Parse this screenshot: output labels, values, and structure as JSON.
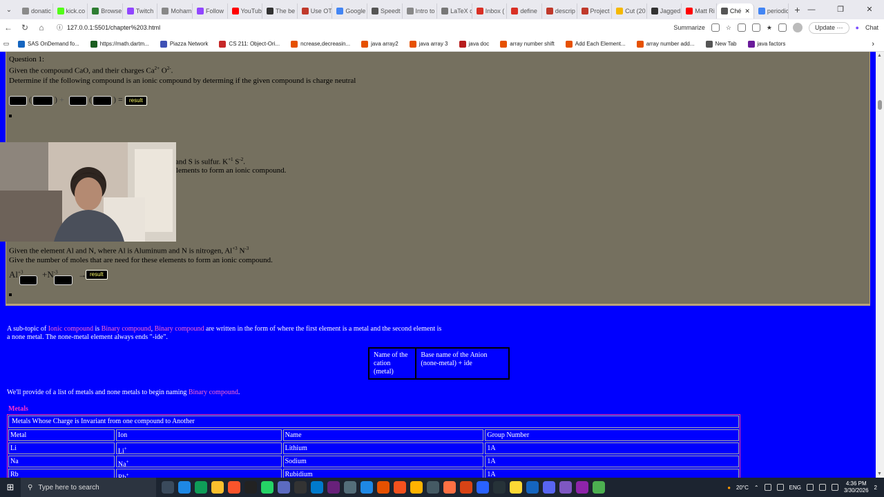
{
  "browser": {
    "tabs": [
      {
        "label": "donatic",
        "color": "#8a8a8a"
      },
      {
        "label": "kick.co",
        "color": "#53fc18"
      },
      {
        "label": "Browse",
        "color": "#2e7d32"
      },
      {
        "label": "Twitch",
        "color": "#9146ff"
      },
      {
        "label": "Moham",
        "color": "#888888"
      },
      {
        "label": "Follow",
        "color": "#9146ff"
      },
      {
        "label": "YouTub",
        "color": "#ff0000"
      },
      {
        "label": "The be",
        "color": "#333333"
      },
      {
        "label": "Use OT",
        "color": "#c0392b"
      },
      {
        "label": "Google",
        "color": "#4285f4"
      },
      {
        "label": "Speedt",
        "color": "#555555"
      },
      {
        "label": "Intro to",
        "color": "#888888"
      },
      {
        "label": "LaTeX c",
        "color": "#777777"
      },
      {
        "label": "Inbox (",
        "color": "#d93025"
      },
      {
        "label": "define",
        "color": "#d93025"
      },
      {
        "label": "descrip",
        "color": "#c0392b"
      },
      {
        "label": "Project",
        "color": "#c0392b"
      },
      {
        "label": "Cut (20",
        "color": "#f5b800"
      },
      {
        "label": "Jagged",
        "color": "#333333"
      },
      {
        "label": "Matt Ri",
        "color": "#ff0000"
      },
      {
        "label": "Ché",
        "color": "#555555",
        "active": true
      },
      {
        "label": "periodic",
        "color": "#4285f4"
      }
    ],
    "url": "127.0.0.1:5501/chapter%203.html",
    "summarize": "Summarize",
    "update": "Update",
    "chat": "Chat",
    "bookmarks": [
      {
        "label": "SAS OnDemand fo...",
        "color": "#1565c0"
      },
      {
        "label": "https://math.dartm...",
        "color": "#1b5e20"
      },
      {
        "label": "Piazza Network",
        "color": "#3f51b5"
      },
      {
        "label": "CS 211: Object-Ori...",
        "color": "#c62828"
      },
      {
        "label": "ncrease,decreasin...",
        "color": "#e65100"
      },
      {
        "label": "java array2",
        "color": "#e65100"
      },
      {
        "label": "java array 3",
        "color": "#e65100"
      },
      {
        "label": "java doc",
        "color": "#b71c1c"
      },
      {
        "label": "array number shift",
        "color": "#e65100"
      },
      {
        "label": "Add Each Element...",
        "color": "#e65100"
      },
      {
        "label": "array number add...",
        "color": "#e65100"
      },
      {
        "label": "New Tab",
        "color": "#555555"
      },
      {
        "label": "java factors",
        "color": "#6a1b9a"
      }
    ]
  },
  "page": {
    "q1": {
      "title": "Question 1:",
      "given_prefix": "Given the compound CaO, and their charges Ca",
      "ca_charge": "2+",
      "o_label": " O",
      "o_charge": "2-",
      "given_suffix": ".",
      "instruction": "Determine if the following compound is an ionic compound by determing if the given compound is charge neutral",
      "plus": "+",
      "equals": "=",
      "result_label": "result"
    },
    "q2": {
      "partial_line1_prefix": "and S is sulfur. K",
      "k_charge": "+1",
      "s_label": " S",
      "s_charge": "-2",
      "partial_line1_suffix": ".",
      "partial_line2": "elements to form an ionic compound."
    },
    "q3": {
      "given_prefix": "Given the element Al and N, where Al is Aluminum and N is nitrogen, Al",
      "al_charge": "+3",
      "n_label": " N",
      "n_charge": "-3",
      "instruction": "Give the number of moles that are need for these elements to form an ionic compound.",
      "al_symbol": "Al",
      "al_sup": "+3",
      "n_symbol": "+N",
      "n_sup": "-3",
      "arrow": "→",
      "result_label": "result"
    },
    "intro": {
      "p1_a": "A sub-topic of ",
      "p1_link1": "Ionic compound",
      "p1_b": " is ",
      "p1_link2": "Binary compound",
      "p1_c": ", ",
      "p1_link3": "Binary compound",
      "p1_d": " are written in the form of where the first element is a metal and the second element is",
      "p1_line2": "a none metal. The none-metal element always ends \"-ide\".",
      "p2_a": "We'll provide of a list of metals and none metals to begin naming ",
      "p2_link": "Binary compound",
      "p2_b": "."
    },
    "name_table": {
      "col1": "Name of the cation (metal)",
      "col2": "Base name of the Anion (none-metal) + ide"
    },
    "metals_link": "Metals",
    "metal_table": {
      "caption": "Metals Whose Charge is Invariant from one compound to Another",
      "headers": [
        "Metal",
        "Ion",
        "Name",
        "Group Number"
      ],
      "rows": [
        {
          "metal": "Li",
          "ion": "Li",
          "ion_charge": "+",
          "name": "Lithium",
          "group": "1A"
        },
        {
          "metal": "Na",
          "ion": "Na",
          "ion_charge": "+",
          "name": "Sodium",
          "group": "1A"
        },
        {
          "metal": "Rb",
          "ion": "Rb",
          "ion_charge": "+",
          "name": "Rubidium",
          "group": "1A"
        }
      ]
    }
  },
  "taskbar": {
    "search_placeholder": "Type here to search",
    "weather": "20°C",
    "language": "ENG",
    "time": "4:36 PM",
    "date": "3/30/2026",
    "notifications": "2"
  }
}
